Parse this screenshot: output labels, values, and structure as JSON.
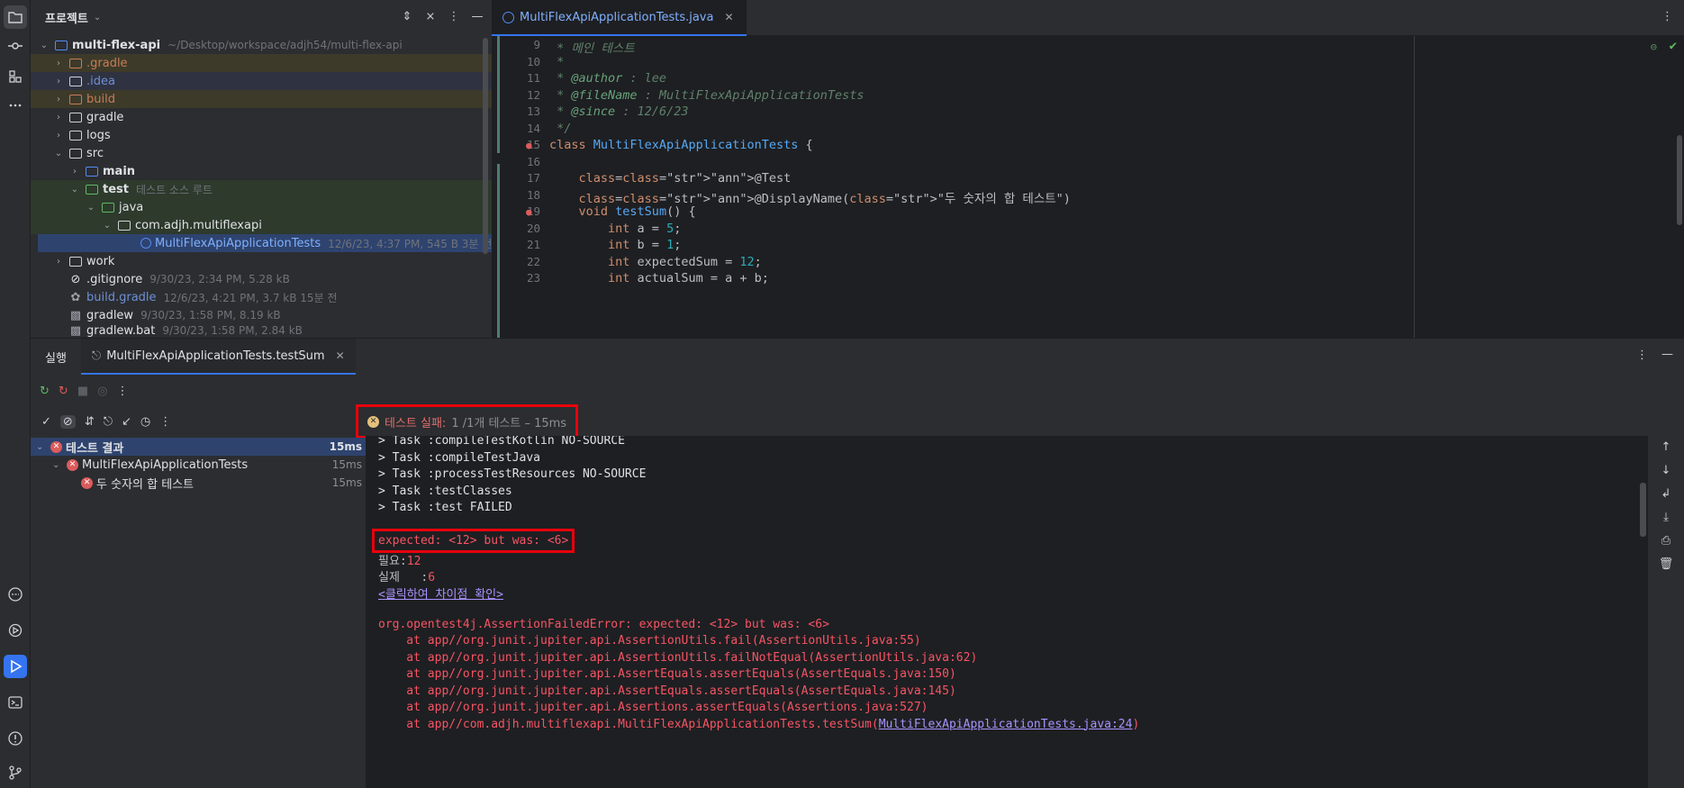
{
  "project": {
    "title": "프로젝트",
    "tree": [
      {
        "label": "multi-flex-api",
        "hint": "~/Desktop/workspace/adjh54/multi-flex-api"
      },
      {
        "label": ".gradle"
      },
      {
        "label": ".idea"
      },
      {
        "label": "build"
      },
      {
        "label": "gradle"
      },
      {
        "label": "logs"
      },
      {
        "label": "src"
      },
      {
        "label": "main"
      },
      {
        "label": "test",
        "hint": "테스트 소스 루트"
      },
      {
        "label": "java"
      },
      {
        "label": "com.adjh.multiflexapi"
      },
      {
        "label": "MultiFlexApiApplicationTests",
        "hint": "12/6/23, 4:37 PM, 545 B 3분 전"
      },
      {
        "label": "work"
      },
      {
        "label": ".gitignore",
        "hint": "9/30/23, 2:34 PM, 5.28 kB"
      },
      {
        "label": "build.gradle",
        "hint": "12/6/23, 4:21 PM, 3.7 kB 15분 전"
      },
      {
        "label": "gradlew",
        "hint": "9/30/23, 1:58 PM, 8.19 kB"
      },
      {
        "label": "gradlew.bat",
        "hint": "9/30/23, 1:58 PM, 2.84 kB"
      }
    ]
  },
  "editor": {
    "tab_label": "MultiFlexApiApplicationTests.java",
    "lines": [
      {
        "n": "9",
        "text": " * 메인 테스트"
      },
      {
        "n": "10",
        "text": " *"
      },
      {
        "n": "11",
        "text": " * @author : lee"
      },
      {
        "n": "12",
        "text": " * @fileName : MultiFlexApiApplicationTests"
      },
      {
        "n": "13",
        "text": " * @since : 12/6/23"
      },
      {
        "n": "14",
        "text": " */"
      },
      {
        "n": "15",
        "text": "class MultiFlexApiApplicationTests {"
      },
      {
        "n": "16",
        "text": ""
      },
      {
        "n": "17",
        "text": "    @Test"
      },
      {
        "n": "18",
        "text": "    @DisplayName(\"두 숫자의 합 테스트\")"
      },
      {
        "n": "19",
        "text": "    void testSum() {"
      },
      {
        "n": "20",
        "text": "        int a = 5;"
      },
      {
        "n": "21",
        "text": "        int b = 1;"
      },
      {
        "n": "22",
        "text": "        int expectedSum = 12;"
      },
      {
        "n": "23",
        "text": "        int actualSum = a + b;"
      }
    ]
  },
  "run": {
    "title": "실행",
    "tab_label": "MultiFlexApiApplicationTests.testSum",
    "status_prefix": "테스트 실패:",
    "status_rest": "1 /1개 테스트 – 15ms",
    "tree": [
      {
        "label": "테스트 결과",
        "time": "15ms"
      },
      {
        "label": "MultiFlexApiApplicationTests",
        "time": "15ms"
      },
      {
        "label": "두 숫자의 합 테스트",
        "time": "15ms"
      }
    ],
    "console": [
      "> Task :compileTestKotlin NO-SOURCE",
      "> Task :compileTestJava",
      "> Task :processTestResources NO-SOURCE",
      "> Task :testClasses",
      "> Task :test FAILED",
      "",
      "expected: <12> but was: <6>",
      "필요:12",
      "실제   :6",
      "<클릭하여 차이점 확인>",
      "",
      "org.opentest4j.AssertionFailedError: expected: <12> but was: <6>",
      "    at app//org.junit.jupiter.api.AssertionUtils.fail(AssertionUtils.java:55)",
      "    at app//org.junit.jupiter.api.AssertionUtils.failNotEqual(AssertionUtils.java:62)",
      "    at app//org.junit.jupiter.api.AssertEquals.assertEquals(AssertEquals.java:150)",
      "    at app//org.junit.jupiter.api.AssertEquals.assertEquals(AssertEquals.java:145)",
      "    at app//org.junit.jupiter.api.Assertions.assertEquals(Assertions.java:527)",
      "    at app//com.adjh.multiflexapi.MultiFlexApiApplicationTests.testSum(",
      "MultiFlexApiApplicationTests.java:24",
      ")"
    ]
  }
}
